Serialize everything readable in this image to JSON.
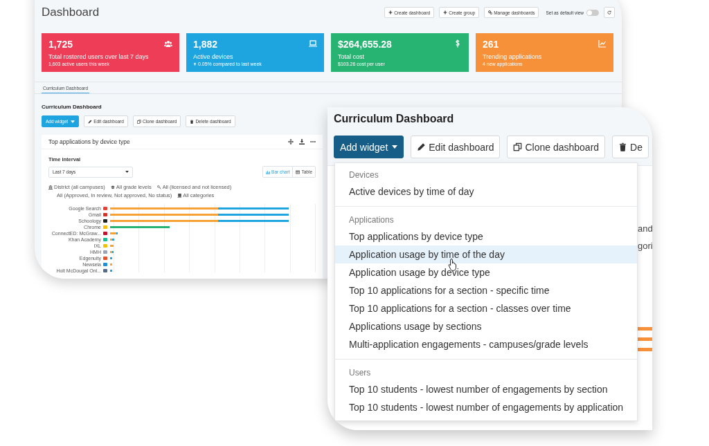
{
  "dashboard": {
    "title": "Dashboard",
    "actions": [
      {
        "label": "Create dashboard",
        "kind": "plus"
      },
      {
        "label": "Create group",
        "kind": "plus"
      },
      {
        "label": "Manage dashboards",
        "kind": "gears"
      }
    ],
    "default_view": {
      "label": "Set as default view",
      "on": false
    }
  },
  "stat_cards": [
    {
      "value": "1,725",
      "label": "Total rostered users over last 7 days",
      "note": "1,603 active users this week",
      "color": "#ee3d56",
      "kind": "users",
      "trend_up": false
    },
    {
      "value": "1,882",
      "label": "Active devices",
      "note": "0.05% compared to last week",
      "color": "#1ea5e0",
      "kind": "laptop",
      "trend_up": true
    },
    {
      "value": "$264,655.28",
      "label": "Total cost",
      "note": "$103.26 cost per user",
      "color": "#27b473",
      "kind": "dollar",
      "trend_up": false
    },
    {
      "value": "261",
      "label": "Trending applications",
      "note": "4 new applications",
      "color": "#f6913a",
      "kind": "trend",
      "trend_up": false
    }
  ],
  "tabs": [
    {
      "label": "Curriculum Dashboard",
      "selected": true
    }
  ],
  "section_title": "Curriculum Dashboard",
  "toolbar": [
    {
      "label": "Add widget",
      "kind": "primary"
    },
    {
      "label": "Edit dashboard",
      "kind": "edit"
    },
    {
      "label": "Clone dashboard",
      "kind": "clone"
    },
    {
      "label": "Delete dashboard",
      "kind": "delete"
    }
  ],
  "widget": {
    "title": "Top applications by device type",
    "time_label": "Time interval",
    "time_value": "Last 7 days",
    "views": [
      {
        "label": "Bar chart",
        "kind": "bars",
        "selected": true
      },
      {
        "label": "Table",
        "kind": "table",
        "selected": false
      }
    ],
    "filters": [
      {
        "label": "District (all campuses)",
        "kind": "building"
      },
      {
        "label": "All grade levels",
        "kind": "cap"
      },
      {
        "label": "All (licensed and not licensed)",
        "kind": "key"
      },
      {
        "label": "All (Approved, In review, Not approved, No status)",
        "kind": "none"
      },
      {
        "label": "All categories",
        "kind": "book"
      }
    ],
    "apps": [
      "Google Search",
      "Gmail",
      "Schoology",
      "Chrome",
      "ConnectED: McGraw...",
      "Khan Academy",
      "IXL",
      "HMH",
      "Edgenuity",
      "Newsela",
      "Holt McDougal Onl..."
    ]
  },
  "zoom": {
    "title": "Curriculum Dashboard",
    "toolbar": [
      {
        "label": "Add widget",
        "kind": "primary"
      },
      {
        "label": "Edit dashboard",
        "kind": "edit"
      },
      {
        "label": "Clone dashboard",
        "kind": "clone"
      },
      {
        "label": "De",
        "kind": "delete"
      }
    ],
    "menu": [
      {
        "heading": "Devices",
        "items": [
          {
            "label": "Active devices by time of day",
            "selected": false
          }
        ]
      },
      {
        "heading": "Applications",
        "items": [
          {
            "label": "Top applications by device type",
            "selected": false
          },
          {
            "label": "Application usage by time of the day",
            "selected": true
          },
          {
            "label": "Application usage by device type",
            "selected": false
          },
          {
            "label": "Top 10 applications for a section - specific time",
            "selected": false
          },
          {
            "label": "Top 10 applications for a section - classes over time",
            "selected": false
          },
          {
            "label": "Applications usage by sections",
            "selected": false
          },
          {
            "label": "Multi-application engagements - campuses/grade levels",
            "selected": false
          }
        ]
      },
      {
        "heading": "Users",
        "items": [
          {
            "label": "Top 10 students - lowest number of engagements by section",
            "selected": false
          },
          {
            "label": "Top 10 students - lowest number of engagements by application",
            "selected": false
          }
        ]
      }
    ],
    "background_fragments": [
      "and",
      "gori"
    ]
  }
}
